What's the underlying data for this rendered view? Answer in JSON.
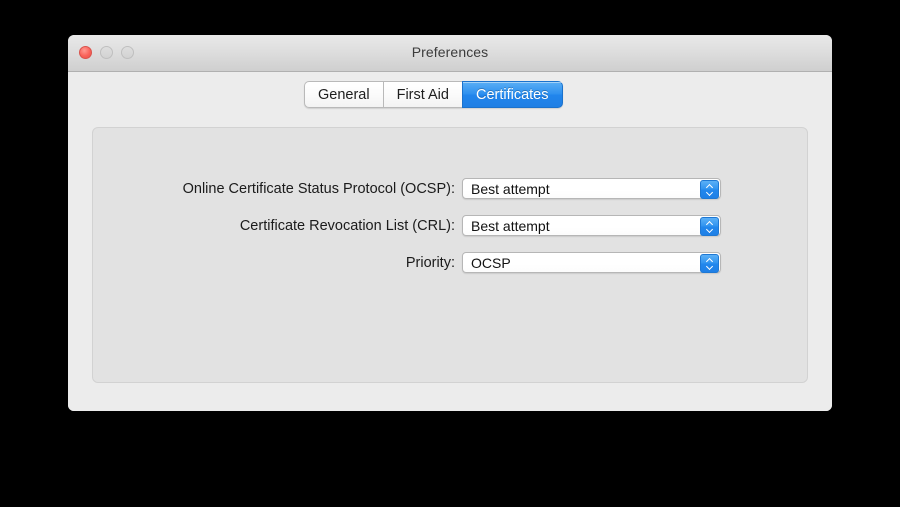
{
  "window": {
    "title": "Preferences",
    "controls": {
      "close": "close-button",
      "minimize": "minimize-button",
      "maximize": "maximize-button"
    }
  },
  "tabs": [
    {
      "label": "General",
      "active": false
    },
    {
      "label": "First Aid",
      "active": false
    },
    {
      "label": "Certificates",
      "active": true
    }
  ],
  "form": {
    "rows": [
      {
        "label": "Online Certificate Status Protocol (OCSP):",
        "value": "Best attempt",
        "name": "ocsp"
      },
      {
        "label": "Certificate Revocation List (CRL):",
        "value": "Best attempt",
        "name": "crl"
      },
      {
        "label": "Priority:",
        "value": "OCSP",
        "name": "priority"
      }
    ]
  },
  "colors": {
    "accent": "#2287ed",
    "close_button": "#f9625a",
    "window_background": "#ececec",
    "panel_background": "#e2e2e2",
    "desktop_background": "#000000"
  }
}
